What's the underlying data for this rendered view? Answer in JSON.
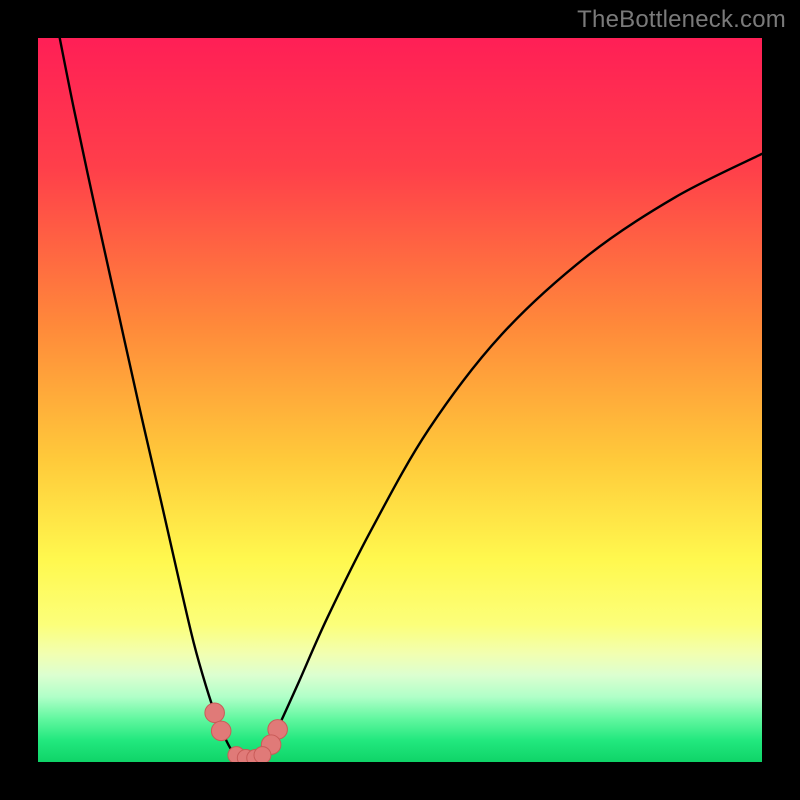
{
  "watermark": "TheBottleneck.com",
  "chart_data": {
    "type": "line",
    "title": "",
    "xlabel": "",
    "ylabel": "",
    "xlim": [
      0,
      100
    ],
    "ylim": [
      0,
      100
    ],
    "gradient_stops": [
      {
        "offset": 0,
        "color": "#ff1f56"
      },
      {
        "offset": 18,
        "color": "#ff3f4a"
      },
      {
        "offset": 40,
        "color": "#ff8a3a"
      },
      {
        "offset": 58,
        "color": "#ffc93a"
      },
      {
        "offset": 72,
        "color": "#fff84e"
      },
      {
        "offset": 81,
        "color": "#fcff7a"
      },
      {
        "offset": 85,
        "color": "#f2ffb0"
      },
      {
        "offset": 88,
        "color": "#dcffd0"
      },
      {
        "offset": 91,
        "color": "#b0ffc8"
      },
      {
        "offset": 94,
        "color": "#62f7a0"
      },
      {
        "offset": 97,
        "color": "#22e87e"
      },
      {
        "offset": 100,
        "color": "#0fd468"
      }
    ],
    "series": [
      {
        "name": "left-lobe",
        "x": [
          3.0,
          5.0,
          8.0,
          11.0,
          14.0,
          17.0,
          19.5,
          21.5,
          23.2,
          24.7,
          25.9,
          26.7,
          27.3
        ],
        "y": [
          100.0,
          90.0,
          76.0,
          62.5,
          49.0,
          36.0,
          25.0,
          16.5,
          10.5,
          6.0,
          3.2,
          1.7,
          1.0
        ]
      },
      {
        "name": "right-lobe",
        "x": [
          31.0,
          32.0,
          33.5,
          36.0,
          40.0,
          46.0,
          54.0,
          64.0,
          76.0,
          88.0,
          100.0
        ],
        "y": [
          1.0,
          2.5,
          5.5,
          11.0,
          20.0,
          32.0,
          46.0,
          59.0,
          70.0,
          78.0,
          84.0
        ]
      },
      {
        "name": "valley-floor",
        "x": [
          27.3,
          28.5,
          29.5,
          30.3,
          31.0
        ],
        "y": [
          1.0,
          0.6,
          0.5,
          0.6,
          1.0
        ]
      }
    ],
    "markers": [
      {
        "name": "left-knee-upper",
        "cx": 24.4,
        "cy": 6.8,
        "r": 1.5
      },
      {
        "name": "left-knee-lower",
        "cx": 25.3,
        "cy": 4.3,
        "r": 1.5
      },
      {
        "name": "right-knee-upper",
        "cx": 33.1,
        "cy": 4.5,
        "r": 1.5
      },
      {
        "name": "right-knee-lower",
        "cx": 32.2,
        "cy": 2.4,
        "r": 1.5
      },
      {
        "name": "floor-1",
        "cx": 27.4,
        "cy": 0.95,
        "r": 1.3
      },
      {
        "name": "floor-2",
        "cx": 28.7,
        "cy": 0.55,
        "r": 1.3
      },
      {
        "name": "floor-3",
        "cx": 30.0,
        "cy": 0.55,
        "r": 1.3
      },
      {
        "name": "floor-4",
        "cx": 31.0,
        "cy": 0.95,
        "r": 1.3
      }
    ],
    "marker_style": {
      "fill": "#e07a78",
      "stroke": "#c95b58"
    },
    "curve_style": {
      "stroke": "#000000",
      "width": 2.4
    }
  }
}
